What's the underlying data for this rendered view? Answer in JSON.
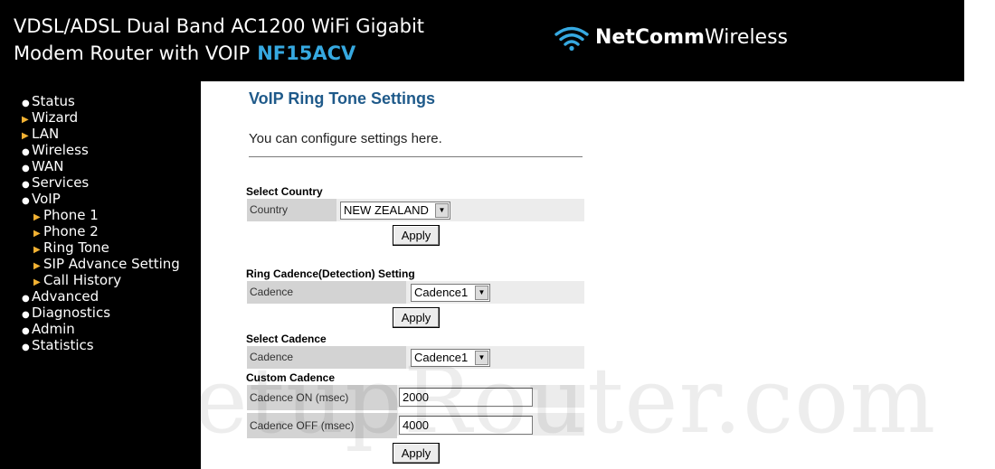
{
  "header": {
    "title_line1": "VDSL/ADSL Dual Band AC1200 WiFi Gigabit",
    "title_line2": "Modem Router with VOIP",
    "model": "NF15ACV",
    "brand_bold": "NetComm",
    "brand_light": "Wireless",
    "brand_icon": "wifi-icon",
    "model_color": "#36a9e1"
  },
  "sidebar": {
    "items": [
      {
        "label": "Status",
        "marker": "dot"
      },
      {
        "label": "Wizard",
        "marker": "triangle"
      },
      {
        "label": "LAN",
        "marker": "triangle"
      },
      {
        "label": "Wireless",
        "marker": "dot"
      },
      {
        "label": "WAN",
        "marker": "dot"
      },
      {
        "label": "Services",
        "marker": "dot"
      },
      {
        "label": "VoIP",
        "marker": "dot"
      },
      {
        "label": "Phone 1",
        "marker": "triangle",
        "sub": true
      },
      {
        "label": "Phone 2",
        "marker": "triangle",
        "sub": true
      },
      {
        "label": "Ring Tone",
        "marker": "triangle",
        "sub": true
      },
      {
        "label": "SIP Advance Setting",
        "marker": "triangle",
        "sub": true
      },
      {
        "label": "Call History",
        "marker": "triangle",
        "sub": true
      },
      {
        "label": "Advanced",
        "marker": "dot"
      },
      {
        "label": "Diagnostics",
        "marker": "dot"
      },
      {
        "label": "Admin",
        "marker": "dot"
      },
      {
        "label": "Statistics",
        "marker": "dot"
      }
    ]
  },
  "main": {
    "title": "VoIP Ring Tone Settings",
    "description": "You can configure settings here.",
    "country_section": {
      "heading": "Select Country",
      "label": "Country",
      "value": "NEW ZEALAND",
      "apply": "Apply"
    },
    "ring_cadence_section": {
      "heading": "Ring Cadence(Detection) Setting",
      "label": "Cadence",
      "value": "Cadence1",
      "apply": "Apply"
    },
    "select_cadence_section": {
      "heading": "Select Cadence",
      "label": "Cadence",
      "value": "Cadence1"
    },
    "custom_cadence_section": {
      "heading": "Custom Cadence",
      "on_label": "Cadence ON (msec)",
      "on_value": "2000",
      "off_label": "Cadence OFF (msec)",
      "off_value": "4000",
      "apply": "Apply"
    }
  },
  "watermark": "SetupRouter.com",
  "colors": {
    "title_blue": "#1f5a8a",
    "nav_triangle": "#f2b233"
  }
}
